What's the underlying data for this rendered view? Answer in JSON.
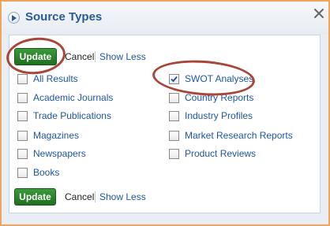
{
  "header": {
    "title": "Source Types",
    "expand_icon": "chevron-right-icon",
    "close_icon": "close-icon"
  },
  "top_actions": {
    "update_label": "Update",
    "cancel_label": "Cancel",
    "show_less_label": "Show Less"
  },
  "bottom_actions": {
    "update_label": "Update",
    "cancel_label": "Cancel",
    "show_less_label": "Show Less"
  },
  "options_left": [
    {
      "label": "All Results",
      "checked": false
    },
    {
      "label": "Academic Journals",
      "checked": false
    },
    {
      "label": "Trade Publications",
      "checked": false
    },
    {
      "label": "Magazines",
      "checked": false
    },
    {
      "label": "Newspapers",
      "checked": false
    },
    {
      "label": "Books",
      "checked": false
    }
  ],
  "options_right": [
    {
      "label": "SWOT Analyses",
      "checked": true
    },
    {
      "label": "Country Reports",
      "checked": false
    },
    {
      "label": "Industry Profiles",
      "checked": false
    },
    {
      "label": "Market Research Reports",
      "checked": false
    },
    {
      "label": "Product Reviews",
      "checked": false
    }
  ],
  "colors": {
    "accent_border": "#f0a45c",
    "title": "#2a5b94",
    "link": "#1f56a3",
    "button": "#2a832a",
    "highlight_ring": "#a9463a"
  }
}
